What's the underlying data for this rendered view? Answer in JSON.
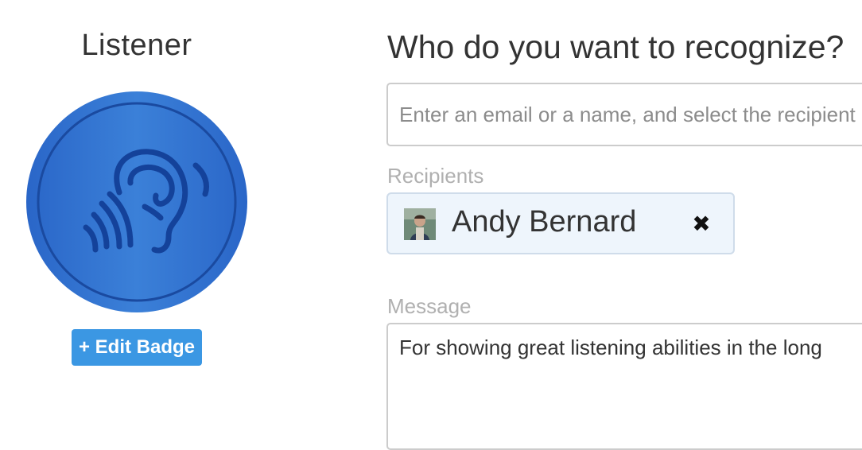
{
  "badge": {
    "title": "Listener",
    "icon": "ear-icon",
    "color": "#2d6fd0",
    "edit_label": "+ Edit Badge"
  },
  "form": {
    "title": "Who do you want to recognize?",
    "search_placeholder": "Enter an email or a name, and select the recipient",
    "recipients_label": "Recipients",
    "recipients": [
      {
        "name": "Andy Bernard",
        "remove_icon": "close-icon"
      }
    ],
    "message_label": "Message",
    "message_value": "For showing great listening abilities in the long"
  },
  "colors": {
    "accent": "#3b97e3",
    "chip_background": "#eef5fc",
    "label": "#b0b0b0"
  }
}
